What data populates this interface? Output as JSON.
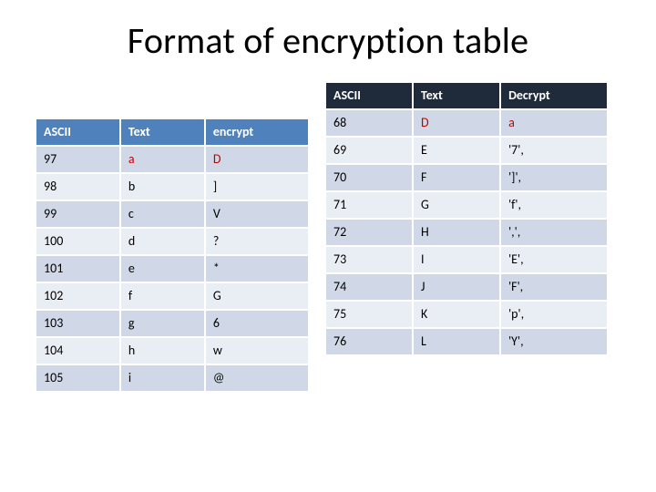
{
  "title": "Format of encryption table",
  "left": {
    "headers": {
      "ascii": "ASCII",
      "text": "Text",
      "encrypt": "encrypt"
    },
    "rows": [
      {
        "ascii": "97",
        "text": "a",
        "encrypt": "D",
        "hl": true
      },
      {
        "ascii": "98",
        "text": "b",
        "encrypt": "]"
      },
      {
        "ascii": "99",
        "text": "c",
        "encrypt": "V"
      },
      {
        "ascii": "100",
        "text": "d",
        "encrypt": "?"
      },
      {
        "ascii": "101",
        "text": "e",
        "encrypt": "*"
      },
      {
        "ascii": "102",
        "text": "f",
        "encrypt": "G"
      },
      {
        "ascii": "103",
        "text": "g",
        "encrypt": "6"
      },
      {
        "ascii": "104",
        "text": "h",
        "encrypt": "w"
      },
      {
        "ascii": "105",
        "text": "i",
        "encrypt": "@"
      }
    ]
  },
  "right": {
    "headers": {
      "ascii": "ASCII",
      "text": "Text",
      "decrypt": "Decrypt"
    },
    "rows": [
      {
        "ascii": "68",
        "text": "D",
        "decrypt": "a",
        "hl": true
      },
      {
        "ascii": "69",
        "text": "E",
        "decrypt": "'7',"
      },
      {
        "ascii": "70",
        "text": "F",
        "decrypt": "']',"
      },
      {
        "ascii": "71",
        "text": "G",
        "decrypt": "'f',"
      },
      {
        "ascii": "72",
        "text": "H",
        "decrypt": "',',"
      },
      {
        "ascii": "73",
        "text": "I",
        "decrypt": "'E',"
      },
      {
        "ascii": "74",
        "text": "J",
        "decrypt": "'F',"
      },
      {
        "ascii": "75",
        "text": "K",
        "decrypt": "'p',"
      },
      {
        "ascii": "76",
        "text": "L",
        "decrypt": "'Y',"
      }
    ]
  }
}
